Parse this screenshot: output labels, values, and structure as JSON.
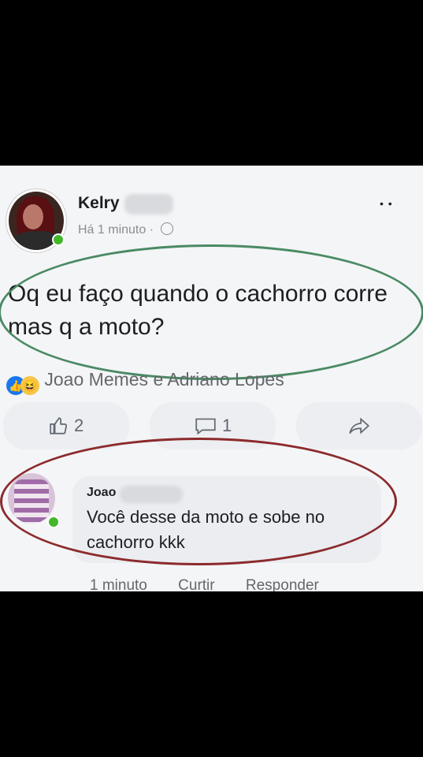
{
  "post": {
    "author": "Kelry",
    "time": "Há 1 minuto",
    "separator": "·",
    "text": "Oq eu faço quando o cachorro corre mas q a moto?",
    "reactions_text": "Joao Memes e Adriano Lopes",
    "like_count": "2",
    "comment_count": "1"
  },
  "comment": {
    "author": "Joao",
    "text": "Você desse da moto e sobe no cachorro kkk",
    "time": "1 minuto",
    "like_label": "Curtir",
    "reply_label": "Responder"
  },
  "icons": {
    "more": "more-icon",
    "globe": "globe-icon",
    "like": "thumbs-up-icon",
    "comment": "comment-icon",
    "share": "share-icon"
  },
  "colors": {
    "green_highlight": "#4a8a64",
    "red_highlight": "#8c2a2c",
    "online": "#42b72a",
    "like_blue": "#1877f2"
  }
}
